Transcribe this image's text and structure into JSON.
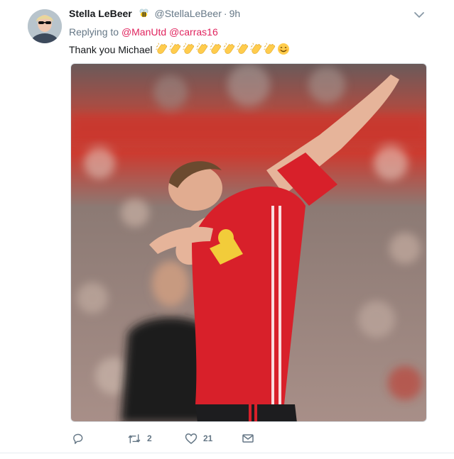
{
  "tweet": {
    "display_name": "Stella LeBeer",
    "name_emoji": "bee",
    "handle": "@StellaLeBeer",
    "separator": "·",
    "time": "9h",
    "replying_prefix": "Replying to",
    "replying_to": [
      "@ManUtd",
      "@carras16"
    ],
    "text": "Thank you Michael",
    "emojis": [
      "clapping-hands",
      "clapping-hands",
      "clapping-hands",
      "clapping-hands",
      "clapping-hands",
      "clapping-hands",
      "clapping-hands",
      "clapping-hands",
      "clapping-hands",
      "smiling-face"
    ],
    "actions": {
      "retweet_count": "2",
      "like_count": "21"
    }
  },
  "colors": {
    "accent_pink": "#e0245e",
    "muted": "#657786",
    "text": "#14171a",
    "kit_red": "#d8202a"
  }
}
